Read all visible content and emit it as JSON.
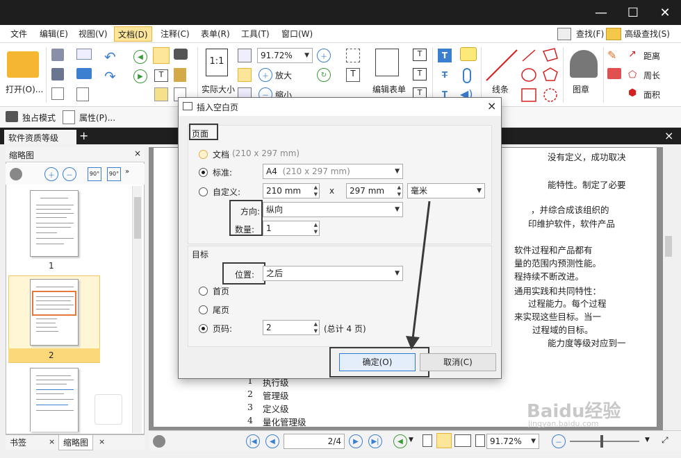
{
  "menubar": {
    "items": [
      "文件",
      "编辑(E)",
      "视图(V)",
      "文档(D)",
      "注释(C)",
      "表单(R)",
      "工具(T)",
      "窗口(W)"
    ],
    "find": "查找(F)",
    "advanced_find": "高级查找(S)"
  },
  "ribbon": {
    "open": "打开(O)...",
    "actual_size": "实际大小",
    "zoom_value": "91.72%",
    "zoom_in": "放大",
    "zoom_out": "缩小",
    "edit_form": "编辑表单",
    "line": "线条",
    "stamp": "图章",
    "distance": "距离",
    "perimeter": "周长",
    "area": "面积"
  },
  "subbar": {
    "exclusive": "独占模式",
    "properties": "属性(P)..."
  },
  "tabs": {
    "document": "软件资质等级",
    "add": "+",
    "close": "×"
  },
  "leftpane": {
    "title": "缩略图",
    "close": "×",
    "pages": [
      "1",
      "2"
    ],
    "bottom_tabs": [
      "书签",
      "缩略图"
    ]
  },
  "document": {
    "lines": [
      "没有定义，成功取决",
      "能特性。制定了必要",
      "，并综合成该组织的",
      "印维护软件，软件产品",
      "软件过程和产品都有",
      "量的范围内预测性能。",
      "程持续不断改进。",
      "通用实践和共同特性：",
      "过程能力。每个过程",
      "来实现这些目标。当一",
      "过程域的目标。",
      "能力度等级对应到一"
    ],
    "list": [
      {
        "num": "1",
        "text": "执行级"
      },
      {
        "num": "2",
        "text": "管理级"
      },
      {
        "num": "3",
        "text": "定义级"
      },
      {
        "num": "4",
        "text": "量化管理级"
      }
    ],
    "watermark": "Baidu经验",
    "watermark_sub": "jingyan.baidu.com"
  },
  "statusbar": {
    "page_value": "2",
    "page_total": "/4",
    "zoom": "91.72%"
  },
  "dialog": {
    "title": "插入空白页",
    "close": "×",
    "page_group": "页面",
    "doc_label": "文档",
    "doc_size": "(210 x 297 mm)",
    "standard_label": "标准:",
    "standard_value": "A4",
    "standard_size": "(210 x 297 mm)",
    "custom_label": "自定义:",
    "width": "210 mm",
    "times": "x",
    "height": "297 mm",
    "unit": "毫米",
    "orientation_label": "方向:",
    "orientation_value": "纵向",
    "count_label": "数量:",
    "count_value": "1",
    "target_group": "目标",
    "position_label": "位置:",
    "position_value": "之后",
    "first_page": "首页",
    "last_page": "尾页",
    "page_num_label": "页码:",
    "page_num_value": "2",
    "total_pages": "(总计 4 页)",
    "ok": "确定(O)",
    "cancel": "取消(C)"
  },
  "colors": {
    "accent": "#2a7bd8",
    "highlight_tab": "#fde69a",
    "titlebar": "#1e1e1e"
  }
}
